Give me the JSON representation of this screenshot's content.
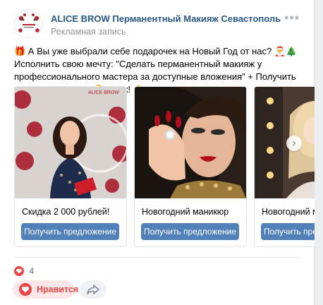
{
  "post": {
    "author": "ALICE BROW Перманентный Макияж Севастополь",
    "ad_label": "Рекламная запись",
    "text": "🎁 А Вы уже выбрали себе подарочек на Новый Год от нас? 🎅🎄 Исполнить свою мечту: \"Сделать перманентный макияж у профессионального мастера за доступные вложения\" + Получить классные подарки!👇 Клик! 👌",
    "likes_count": "4",
    "like_label": "Нравится"
  },
  "carousel": {
    "cards": [
      {
        "title": "Скидка 2 000 рублей!",
        "button": "Получить предложение"
      },
      {
        "title": "Новогодний маникюр",
        "button": "Получить предложение"
      },
      {
        "title": "Новогодний макияж",
        "button": "Получить предложение"
      }
    ]
  },
  "colors": {
    "link": "#2a5885",
    "button": "#5181b8",
    "like": "#e64646"
  },
  "icons": {
    "more": "more-horizontal-icon",
    "next": "chevron-right-icon",
    "like": "heart-icon",
    "share": "share-icon"
  }
}
